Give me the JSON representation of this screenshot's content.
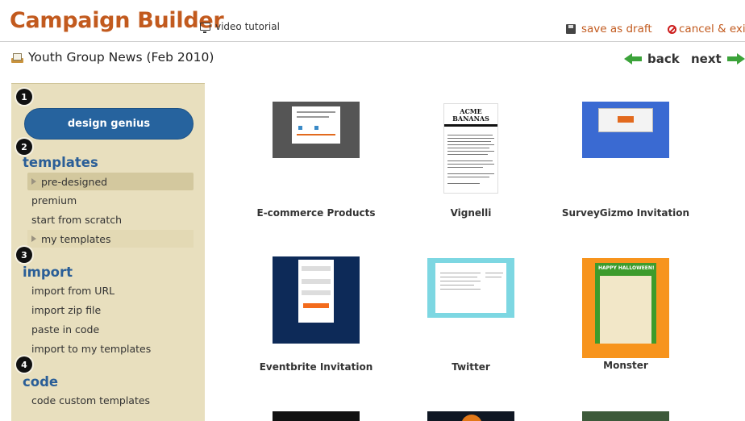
{
  "header": {
    "title": "Campaign Builder",
    "video_tutorial": "video tutorial",
    "save_as_draft": "save as draft",
    "cancel_exit": "cancel & exit",
    "accent_color": "#c25a1e"
  },
  "campaign": {
    "name": "Youth Group News (Feb 2010)",
    "back": "back",
    "next": "next"
  },
  "sidebar": {
    "steps": [
      "1",
      "2",
      "3",
      "4"
    ],
    "design_genius": "design genius",
    "templates_title": "templates",
    "templates_items": [
      "pre-designed",
      "premium",
      "start from scratch",
      "my templates"
    ],
    "import_title": "import",
    "import_items": [
      "import from URL",
      "import zip file",
      "paste in code",
      "import to my templates"
    ],
    "code_title": "code",
    "code_items": [
      "code custom templates"
    ]
  },
  "templates": [
    {
      "name": "E-commerce Products"
    },
    {
      "name": "Vignelli"
    },
    {
      "name": "SurveyGizmo Invitation"
    },
    {
      "name": "Eventbrite Invitation"
    },
    {
      "name": "Twitter"
    },
    {
      "name": "Monster"
    }
  ],
  "thumb_text": {
    "vignelli_brand": "ACME\nBANANAS",
    "monster_banner": "HAPPY HALLOWEEN!"
  }
}
